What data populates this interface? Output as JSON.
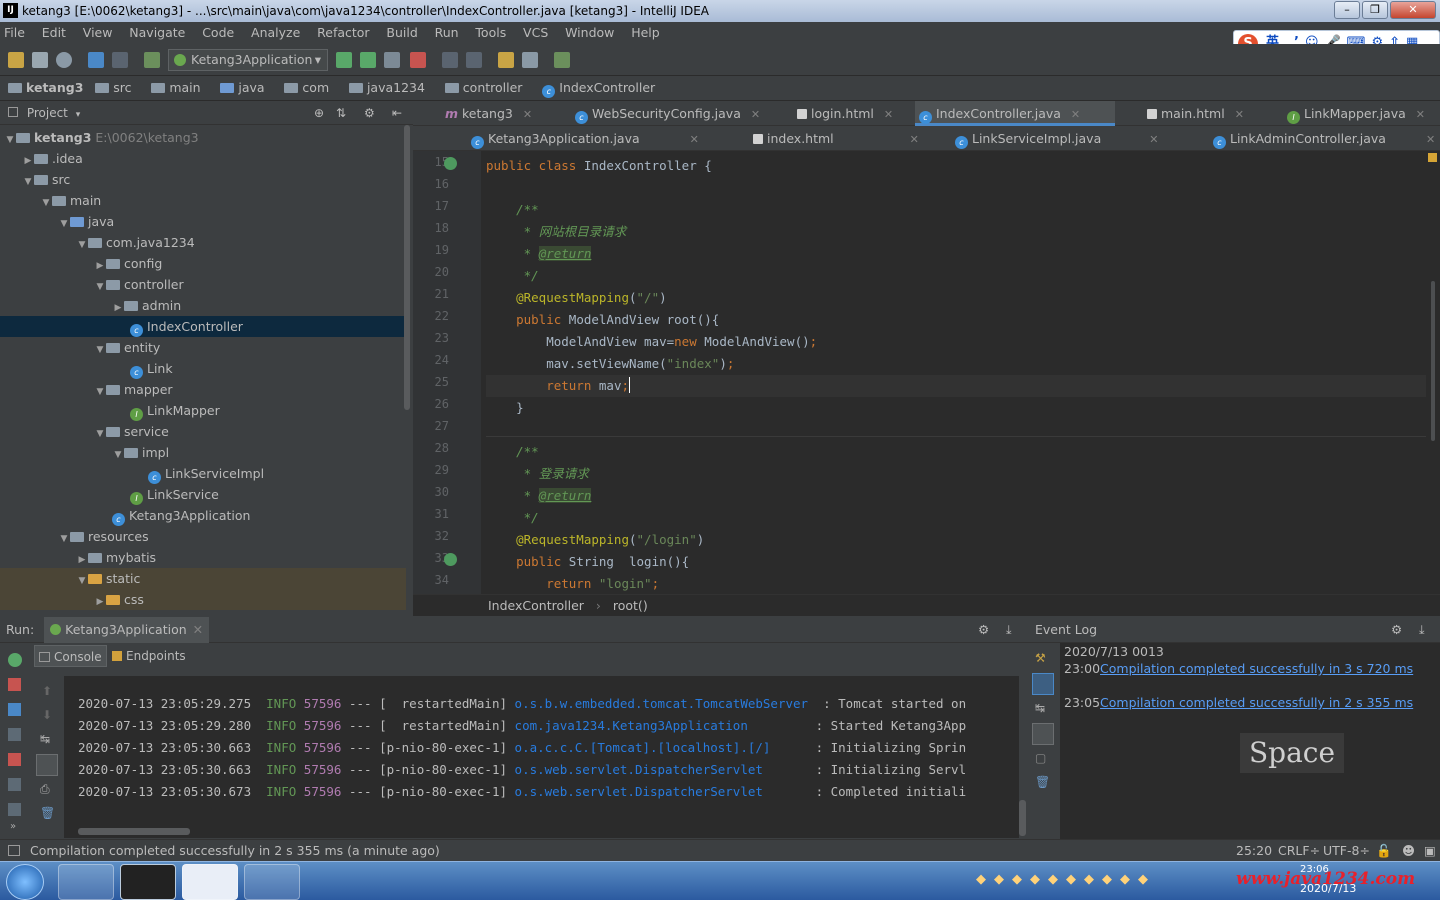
{
  "window": {
    "title": "ketang3 [E:\\0062\\ketang3] - ...\\src\\main\\java\\com\\java1234\\controller\\IndexController.java [ketang3] - IntelliJ IDEA",
    "app_icon": "IJ"
  },
  "menu": [
    "File",
    "Edit",
    "View",
    "Navigate",
    "Code",
    "Analyze",
    "Refactor",
    "Build",
    "Run",
    "Tools",
    "VCS",
    "Window",
    "Help"
  ],
  "toolbar": {
    "run_config": "Ketang3Application"
  },
  "navbar": [
    "ketang3",
    "src",
    "main",
    "java",
    "com",
    "java1234",
    "controller",
    "IndexController"
  ],
  "project": {
    "header": "Project",
    "root_name": "ketang3",
    "root_path": "E:\\0062\\ketang3"
  },
  "tree": [
    {
      "label": ".idea"
    },
    {
      "label": "src"
    },
    {
      "label": "main"
    },
    {
      "label": "java"
    },
    {
      "label": "com.java1234"
    },
    {
      "label": "config"
    },
    {
      "label": "controller"
    },
    {
      "label": "admin"
    },
    {
      "label": "IndexController"
    },
    {
      "label": "entity"
    },
    {
      "label": "Link"
    },
    {
      "label": "mapper"
    },
    {
      "label": "LinkMapper"
    },
    {
      "label": "service"
    },
    {
      "label": "impl"
    },
    {
      "label": "LinkServiceImpl"
    },
    {
      "label": "LinkService"
    },
    {
      "label": "Ketang3Application"
    },
    {
      "label": "resources"
    },
    {
      "label": "mybatis"
    },
    {
      "label": "static"
    },
    {
      "label": "css"
    }
  ],
  "tabs_row1": [
    "ketang3",
    "WebSecurityConfig.java",
    "login.html",
    "IndexController.java",
    "main.html",
    "LinkMapper.java"
  ],
  "tabs_row2": [
    "Ketang3Application.java",
    "index.html",
    "LinkServiceImpl.java",
    "LinkAdminController.java"
  ],
  "line_numbers": [
    "15",
    "16",
    "17",
    "18",
    "19",
    "20",
    "21",
    "22",
    "23",
    "24",
    "25",
    "26",
    "27",
    "28",
    "29",
    "30",
    "31",
    "32",
    "33",
    "34"
  ],
  "code": {
    "l15a": "public class ",
    "l15b": "IndexController {",
    "l17": "    /**",
    "l18a": "     * ",
    "l18b": "网站根目录请求",
    "l19a": "     * ",
    "l19b": "@return",
    "l20": "     */",
    "l21a": "    @RequestMapping",
    "l21b": "(",
    "l21c": "\"/\"",
    "l21d": ")",
    "l22a": "    public ",
    "l22b": "ModelAndView root(){",
    "l23a": "        ModelAndView mav=",
    "l23b": "new ",
    "l23c": "ModelAndView()",
    "l23d": ";",
    "l24a": "        mav.setViewName(",
    "l24b": "\"index\"",
    "l24c": ")",
    "l24d": ";",
    "l25a": "        return ",
    "l25b": "mav",
    "l25c": ";",
    "l26": "    }",
    "l28": "    /**",
    "l29a": "     * ",
    "l29b": "登录请求",
    "l30a": "     * ",
    "l30b": "@return",
    "l31": "     */",
    "l32a": "    @RequestMapping",
    "l32b": "(",
    "l32c": "\"/login\"",
    "l32d": ")",
    "l33a": "    public ",
    "l33b": "String  login(){",
    "l34a": "        return ",
    "l34b": "\"login\"",
    "l34c": ";"
  },
  "breadcrumb": {
    "class": "IndexController",
    "method": "root()"
  },
  "run": {
    "label": "Run:",
    "config": "Ketang3Application",
    "tab_console": "Console",
    "tab_endpoints": "Endpoints"
  },
  "log": [
    {
      "ts": "2020-07-13 23:05:29.275",
      "lvl": "INFO",
      "pid": "57596",
      "sep": "---",
      "th": "[  restartedMain]",
      "logger": "o.s.b.w.embedded.tomcat.TomcatWebServer ",
      "msg": ": Tomcat started on"
    },
    {
      "ts": "2020-07-13 23:05:29.280",
      "lvl": "INFO",
      "pid": "57596",
      "sep": "---",
      "th": "[  restartedMain]",
      "logger": "com.java1234.Ketang3Application        ",
      "msg": ": Started Ketang3App"
    },
    {
      "ts": "2020-07-13 23:05:30.663",
      "lvl": "INFO",
      "pid": "57596",
      "sep": "---",
      "th": "[p-nio-80-exec-1]",
      "logger": "o.a.c.c.C.[Tomcat].[localhost].[/]     ",
      "msg": ": Initializing Sprin"
    },
    {
      "ts": "2020-07-13 23:05:30.663",
      "lvl": "INFO",
      "pid": "57596",
      "sep": "---",
      "th": "[p-nio-80-exec-1]",
      "logger": "o.s.web.servlet.DispatcherServlet      ",
      "msg": ": Initializing Servl"
    },
    {
      "ts": "2020-07-13 23:05:30.673",
      "lvl": "INFO",
      "pid": "57596",
      "sep": "---",
      "th": "[p-nio-80-exec-1]",
      "logger": "o.s.web.servlet.DispatcherServlet      ",
      "msg": ": Completed initiali"
    }
  ],
  "eventlog": {
    "title": "Event Log",
    "date": "2020/7/13 0013",
    "entries": [
      {
        "time": "23:00",
        "text": "Compilation completed successfully in 3 s 720 ms"
      },
      {
        "time": "23:05",
        "text": "Compilation completed successfully in 2 s 355 ms"
      }
    ],
    "overlay": "Space"
  },
  "status": {
    "message": "Compilation completed successfully in 2 s 355 ms (a minute ago)",
    "position": "25:20",
    "line_sep": "CRLF÷",
    "encoding": "UTF-8÷"
  },
  "taskbar": {
    "watermark": "www.java1234.com",
    "time": "23:06",
    "date": "2020/7/13"
  },
  "ime": {
    "lang": "英"
  },
  "colors": {
    "bg": "#2b2b2b",
    "panel": "#3c3f41",
    "keyword": "#cc7832",
    "string": "#6a8759",
    "annotation": "#bbb529",
    "comment": "#629755",
    "link": "#589df6",
    "selection": "#0d293e"
  }
}
